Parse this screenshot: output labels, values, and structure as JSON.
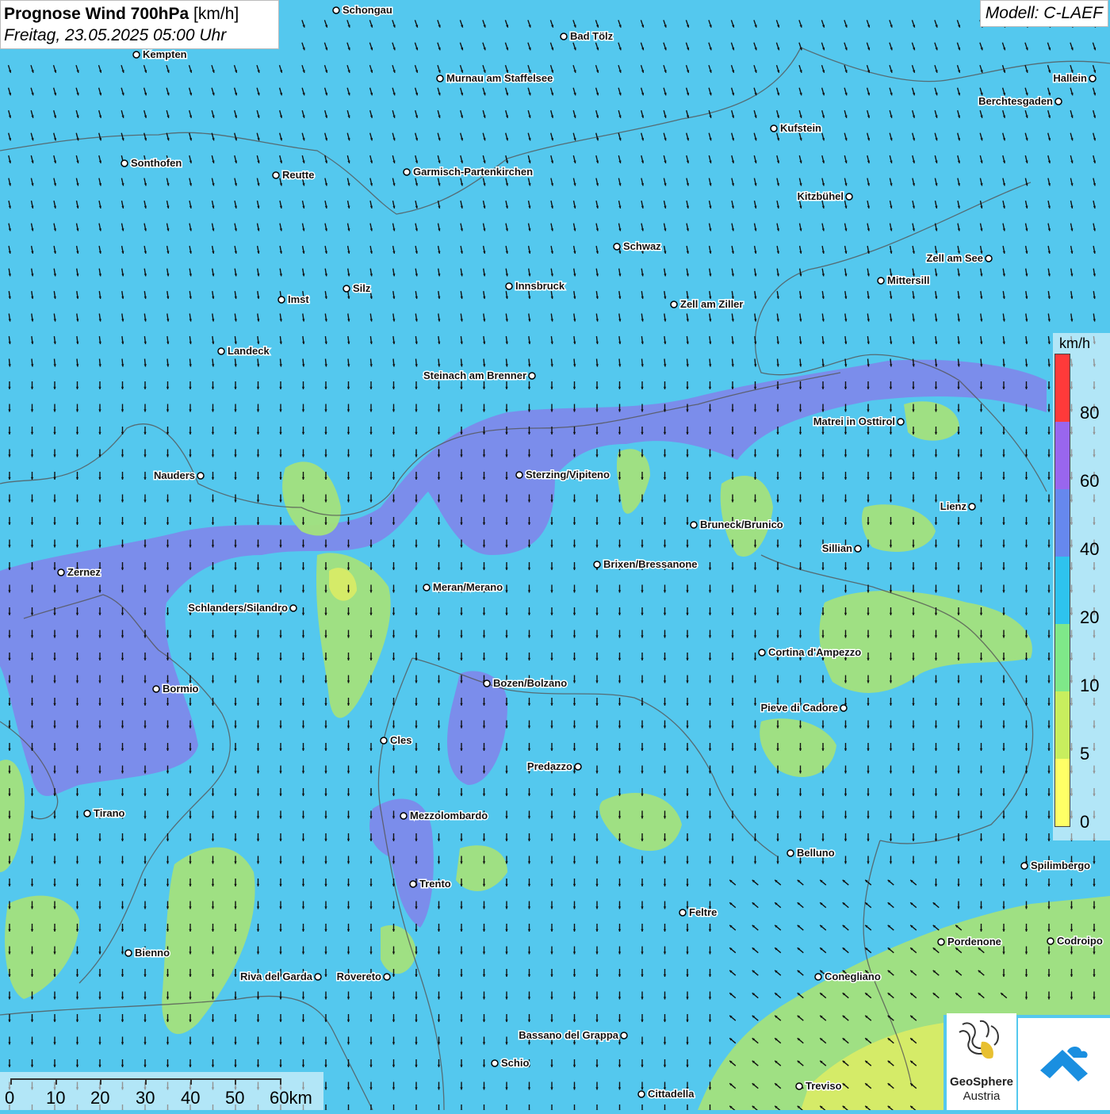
{
  "header": {
    "title_bold": "Prognose Wind 700hPa",
    "title_unit": "[km/h]",
    "subtitle": "Freitag, 23.05.2025 05:00 Uhr",
    "model": "Modell: C-LAEF"
  },
  "legend": {
    "unit": "km/h",
    "ticks": [
      "80",
      "60",
      "40",
      "20",
      "10",
      "5",
      "0"
    ],
    "colors": [
      "#ff3a3a",
      "#9966ee",
      "#6688ee",
      "#2ec3ee",
      "#7fe889",
      "#c8ee5e",
      "#ffff66"
    ]
  },
  "colors": {
    "background": "#54c8ee",
    "purple_zone": "#7f86ea",
    "green_zone": "#a3e27c",
    "yellow_zone": "#d8eb66",
    "border_line": "#555555",
    "arrow": "#111111"
  },
  "scale": {
    "labels": [
      "0",
      "10",
      "20",
      "30",
      "40",
      "50",
      "60km"
    ]
  },
  "logos": {
    "geosphere_line1": "GeoSphere",
    "geosphere_line2": "Austria"
  },
  "cities": [
    {
      "name": "Schongau"
    },
    {
      "name": "Bad Tölz"
    },
    {
      "name": "Kempten"
    },
    {
      "name": "Murnau am Staffelsee"
    },
    {
      "name": "Hallein"
    },
    {
      "name": "Berchtesgaden"
    },
    {
      "name": "Kufstein"
    },
    {
      "name": "Sonthofen"
    },
    {
      "name": "Reutte"
    },
    {
      "name": "Garmisch-Partenkirchen"
    },
    {
      "name": "Kitzbühel"
    },
    {
      "name": "Schwaz"
    },
    {
      "name": "Zell am See"
    },
    {
      "name": "Mittersill"
    },
    {
      "name": "Silz"
    },
    {
      "name": "Innsbruck"
    },
    {
      "name": "Imst"
    },
    {
      "name": "Zell am Ziller"
    },
    {
      "name": "Landeck"
    },
    {
      "name": "Steinach am Brenner"
    },
    {
      "name": "Matrei in Osttirol"
    },
    {
      "name": "Nauders"
    },
    {
      "name": "Sterzing/Vipiteno"
    },
    {
      "name": "Lienz"
    },
    {
      "name": "Bruneck/Brunico"
    },
    {
      "name": "Sillian"
    },
    {
      "name": "Zernez"
    },
    {
      "name": "Brixen/Bressanone"
    },
    {
      "name": "Meran/Merano"
    },
    {
      "name": "Schlanders/Silandro"
    },
    {
      "name": "Cortina d'Ampezzo"
    },
    {
      "name": "Bormio"
    },
    {
      "name": "Bozen/Bolzano"
    },
    {
      "name": "Pieve di Cadore"
    },
    {
      "name": "Cles"
    },
    {
      "name": "Predazzo"
    },
    {
      "name": "Tirano"
    },
    {
      "name": "Mezzolombardo"
    },
    {
      "name": "Belluno"
    },
    {
      "name": "Spilimbergo"
    },
    {
      "name": "Trento"
    },
    {
      "name": "Feltre"
    },
    {
      "name": "Pordenone"
    },
    {
      "name": "Codroipo"
    },
    {
      "name": "Bienno"
    },
    {
      "name": "Riva del Garda"
    },
    {
      "name": "Rovereto"
    },
    {
      "name": "Conegliano"
    },
    {
      "name": "Bassano del Grappa"
    },
    {
      "name": "Schio"
    },
    {
      "name": "Treviso"
    },
    {
      "name": "Cittadella"
    }
  ]
}
